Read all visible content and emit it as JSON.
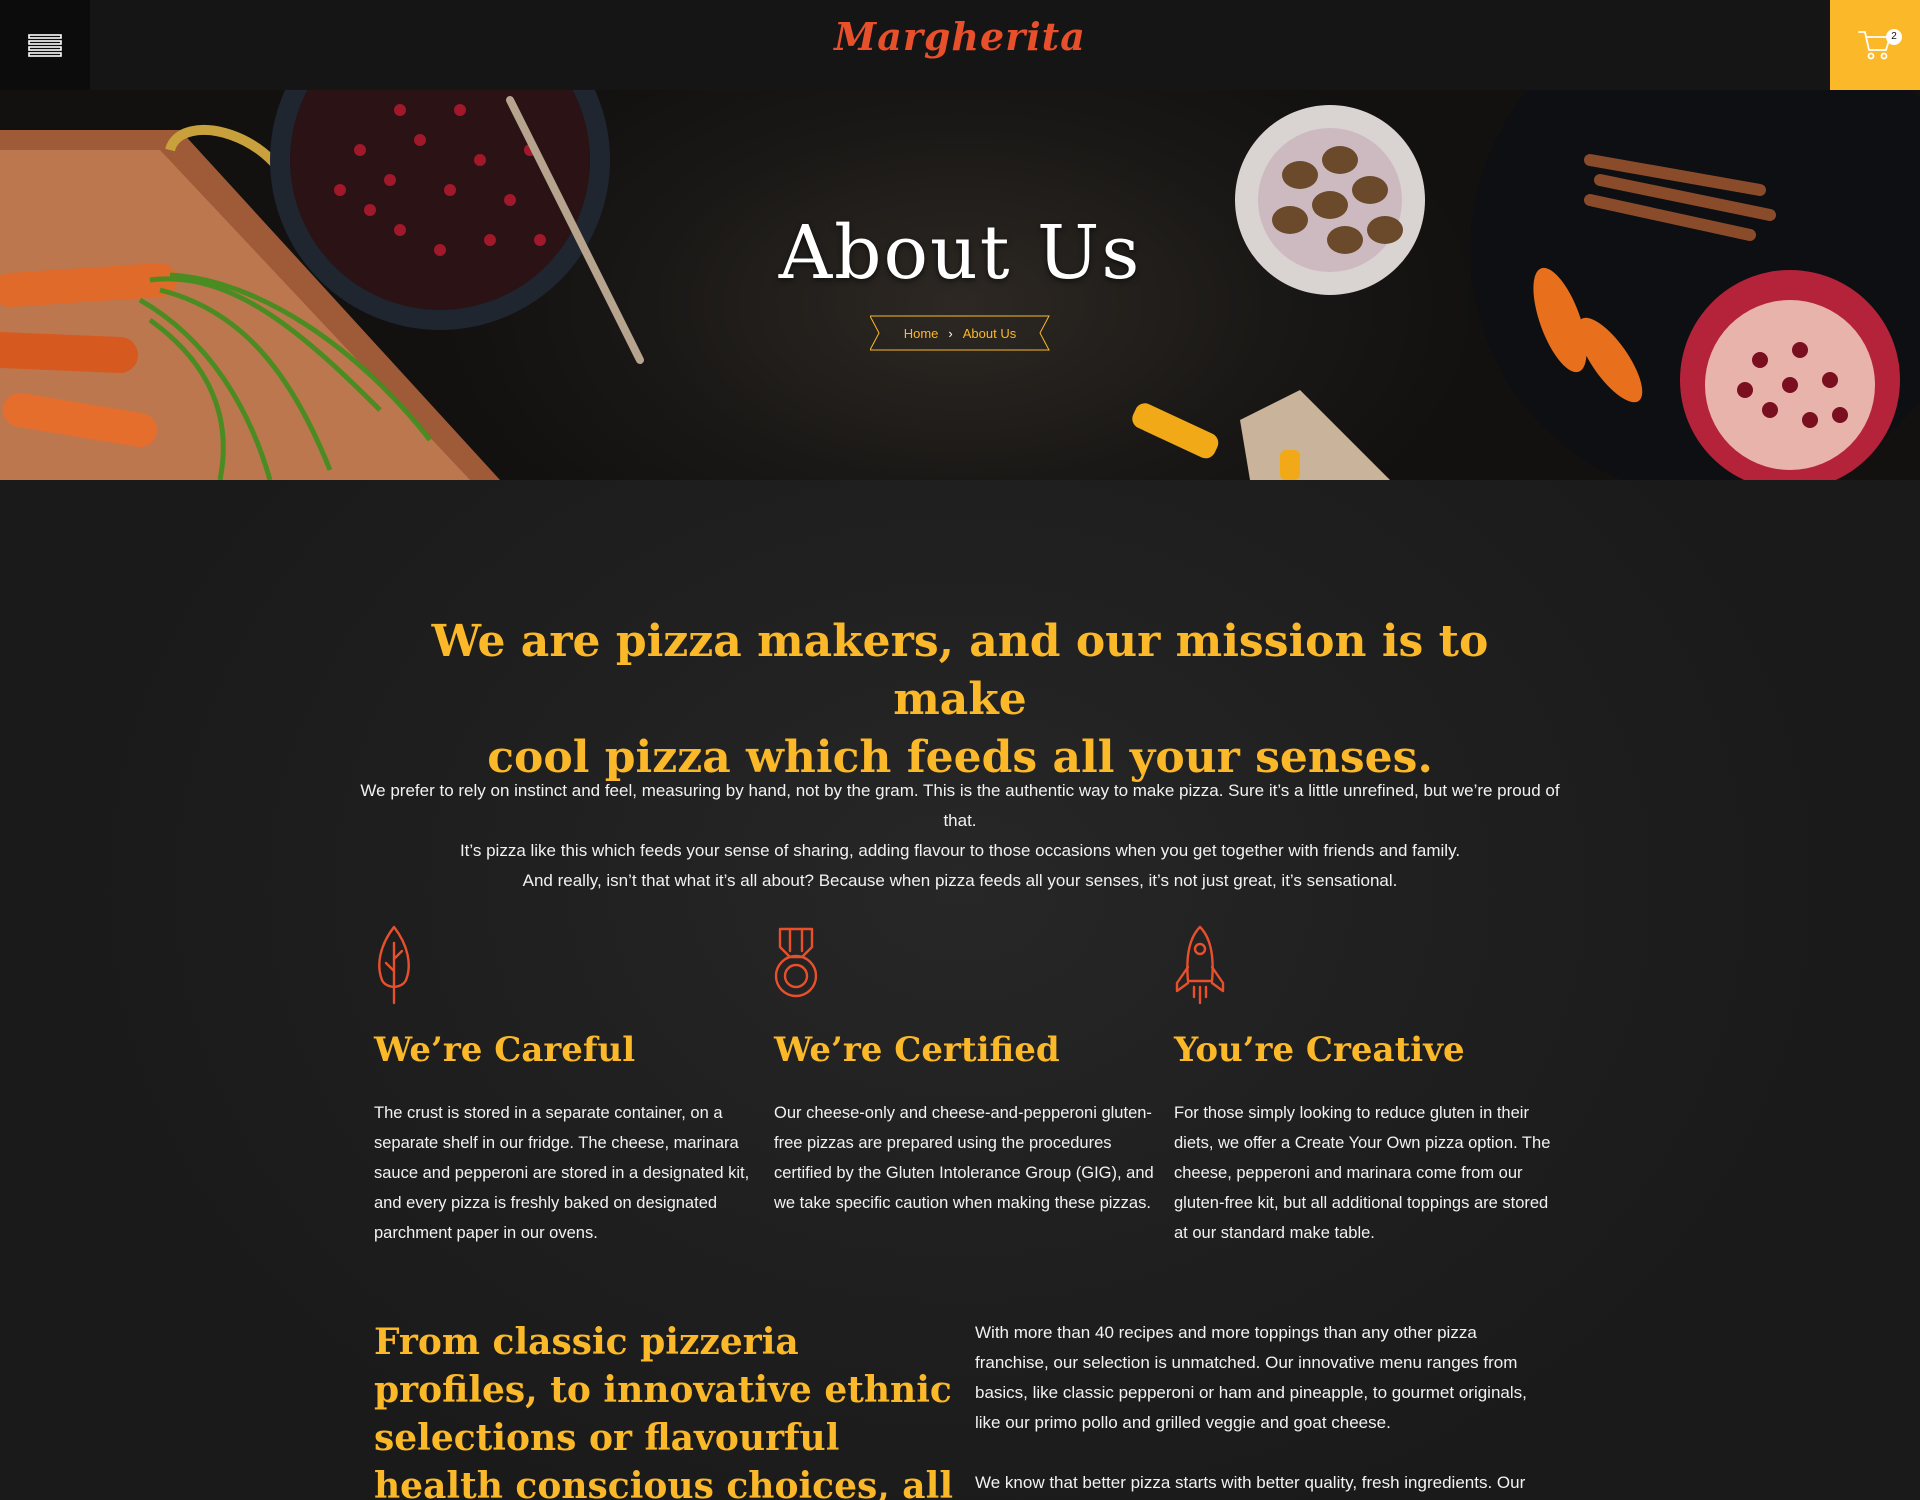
{
  "header": {
    "logo": "Margherita",
    "cart_count": "2",
    "accent": "#fbb829",
    "logo_color": "#e8502c"
  },
  "hero": {
    "title": "About Us",
    "breadcrumb": {
      "home": "Home",
      "current": "About Us"
    }
  },
  "intro": {
    "headline_line1": "We are pizza makers, and our mission is to make",
    "headline_line2": "cool pizza which feeds all your senses.",
    "paragraph_line1": "We prefer to rely on instinct and feel, measuring by hand, not by the gram. This is the authentic way to make pizza. Sure it’s a little unrefined, but we’re proud of that.",
    "paragraph_line2": "It’s pizza like this which feeds your sense of sharing, adding flavour to those occasions when you get together with friends and family.",
    "paragraph_line3": "And really, isn’t that what it’s all about? Because when pizza feeds all your senses, it’s not just great, it’s sensational."
  },
  "features": [
    {
      "icon": "leaf-icon",
      "title": "We’re Careful",
      "text": "The crust is stored in a separate container, on a separate shelf in our fridge. The cheese, marinara sauce and pepperoni are stored in a  designated kit, and every pizza is freshly baked on designated parchment paper in our ovens."
    },
    {
      "icon": "medal-icon",
      "title": "We’re Certified",
      "text": "Our cheese-only and cheese-and-pepperoni gluten-free pizzas are prepared using the procedures certified by the Gluten Intolerance Group (GIG), and we take specific caution when making these pizzas."
    },
    {
      "icon": "rocket-icon",
      "title": "You’re Creative",
      "text": "For those simply looking to reduce gluten in their diets, we offer a Create Your Own pizza option. The cheese, pepperoni and marinara come from our gluten-free kit, but all additional toppings are stored at our standard make table."
    }
  ],
  "classic": {
    "headline": "From classic pizzeria profiles, to innovative ethnic selections or flavourful health conscious choices, all our products reflect",
    "paragraph1": "With more than 40 recipes and more toppings than any other pizza franchise, our selection is unmatched. Our innovative menu ranges from basics, like classic pepperoni or ham and pineapple, to gourmet originals, like our primo pollo and grilled veggie and goat cheese.",
    "paragraph2": "We know that better pizza starts with better quality, fresh ingredients. Our"
  }
}
